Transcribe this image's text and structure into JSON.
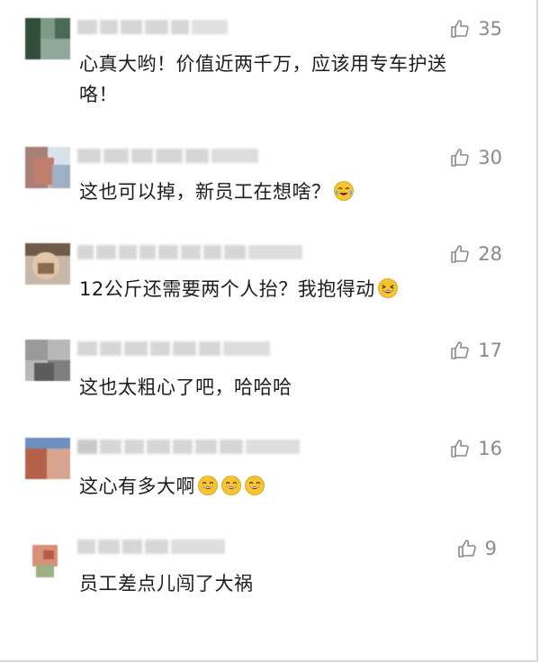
{
  "comments": [
    {
      "likes": "35",
      "text": "心真大哟！价值近两千万，应该用专车护送咯！",
      "emojis": []
    },
    {
      "likes": "30",
      "text": "这也可以掉，新员工在想啥？",
      "emojis": [
        "crying-laughing-emoji"
      ]
    },
    {
      "likes": "28",
      "text": "12公斤还需要两个人抬？我抱得动",
      "emojis": [
        "laughing-emoji"
      ]
    },
    {
      "likes": "17",
      "text": "这也太粗心了吧，哈哈哈",
      "emojis": []
    },
    {
      "likes": "16",
      "text": "这心有多大啊",
      "emojis": [
        "grinning-emoji",
        "grinning-emoji",
        "grinning-emoji"
      ]
    },
    {
      "likes": "9",
      "text": "员工差点儿闯了大祸",
      "emojis": []
    }
  ],
  "colors": {
    "like_gray": "#8a8a8a",
    "emoji_yellow": "#f7c531",
    "text": "#1d1d1d"
  },
  "icons": {
    "like": "thumbs-up-icon"
  }
}
